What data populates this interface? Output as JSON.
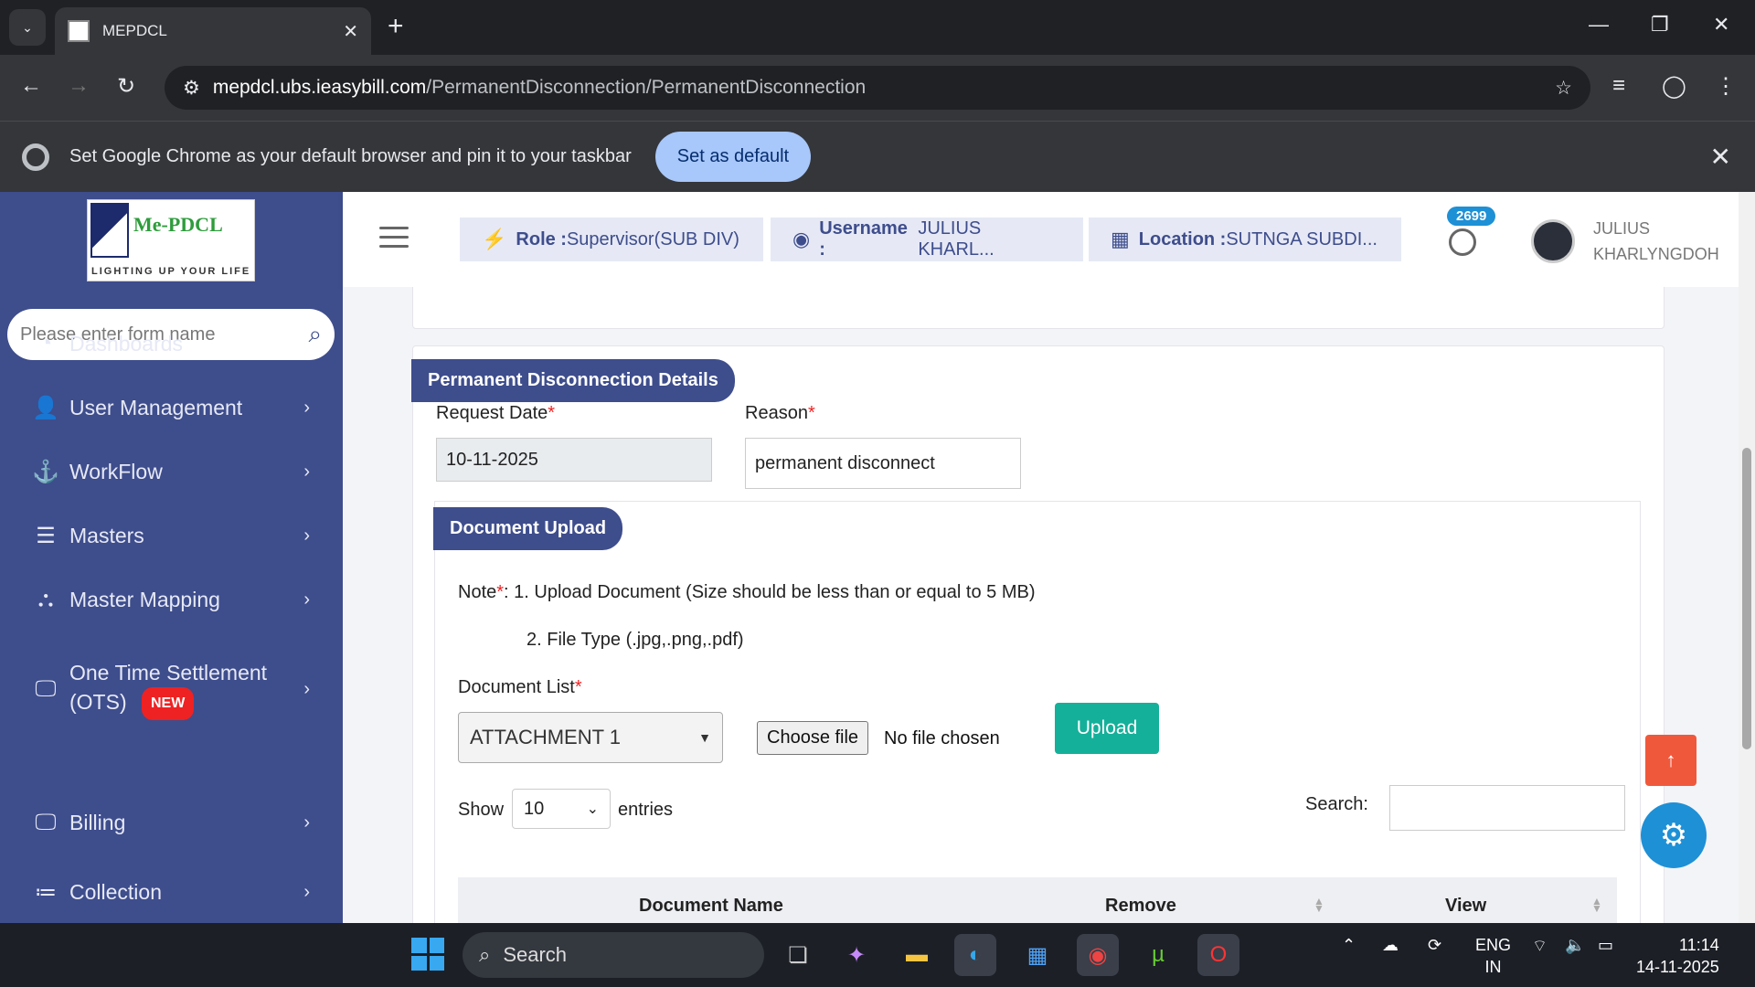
{
  "browser": {
    "tab_title": "MEPDCL",
    "url_host": "mepdcl.ubs.ieasybill.com",
    "url_path": "/PermanentDisconnection/PermanentDisconnection",
    "infobar_text": "Set Google Chrome as your default browser and pin it to your taskbar",
    "infobar_button": "Set as default"
  },
  "sidebar": {
    "logo_text": "Me-PDCL",
    "logo_tagline": "LIGHTING UP YOUR LIFE",
    "search_placeholder": "Please enter form name",
    "items": [
      {
        "label": "Dashboards",
        "icon": "dashboard-icon"
      },
      {
        "label": "User Management",
        "icon": "user-icon"
      },
      {
        "label": "WorkFlow",
        "icon": "anchor-icon"
      },
      {
        "label": "Masters",
        "icon": "list-icon"
      },
      {
        "label": "Master Mapping",
        "icon": "sitemap-icon"
      },
      {
        "label": "One Time Settlement",
        "label2": "(OTS)",
        "badge": "NEW",
        "icon": "monitor-icon"
      },
      {
        "label": "Billing",
        "icon": "monitor-icon"
      },
      {
        "label": "Collection",
        "icon": "list-icon"
      }
    ]
  },
  "header": {
    "role_label": "Role :",
    "role_value": "Supervisor(SUB DIV)",
    "username_label": "Username :",
    "username_value": "JULIUS KHARL...",
    "location_label": "Location :",
    "location_value": "SUTNGA SUBDI...",
    "notification_count": "2699",
    "user_first": "JULIUS",
    "user_last": "KHARLYNGDOH"
  },
  "form": {
    "section_title": "Permanent Disconnection Details",
    "request_date_label": "Request Date",
    "request_date_value": "10-11-2025",
    "reason_label": "Reason",
    "reason_value": "permanent disconnect",
    "required_mark": "*",
    "upload_section_title": "Document Upload",
    "note_label": "Note",
    "note_line1": ": 1. Upload Document (Size should be less than or equal to 5 MB)",
    "note_line2": "2. File Type (.jpg,.png,.pdf)",
    "doc_list_label": "Document List",
    "doc_list_value": "ATTACHMENT 1",
    "choose_file": "Choose file",
    "no_file": "No file chosen",
    "upload_button": "Upload",
    "show_label": "Show",
    "show_value": "10",
    "entries_label": "entries",
    "search_label": "Search:",
    "search_value": "",
    "columns": [
      "Document Name",
      "Remove",
      "View"
    ]
  },
  "taskbar": {
    "search_label": "Search",
    "lang": "ENG",
    "region": "IN",
    "time": "11:14",
    "date": "14-11-2025"
  },
  "colors": {
    "sidebar": "#3e4d8c",
    "accent_upload": "#15b09a",
    "scroll_top": "#f0583c",
    "fab": "#1e90d6"
  }
}
